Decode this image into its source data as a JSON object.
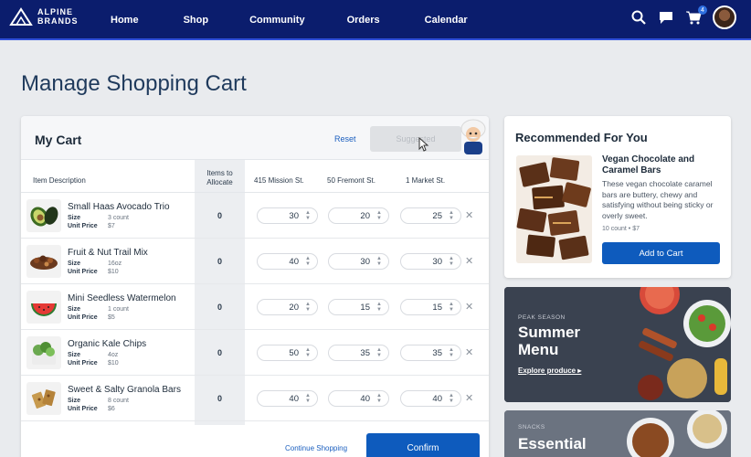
{
  "nav": {
    "brand_line1": "ALPINE",
    "brand_line2": "BRANDS",
    "links": [
      "Home",
      "Shop",
      "Community",
      "Orders",
      "Calendar"
    ],
    "cart_count": "4",
    "icons": [
      "search-icon",
      "chat-icon",
      "cart-icon",
      "avatar"
    ]
  },
  "page": {
    "title": "Manage Shopping Cart"
  },
  "cart": {
    "title": "My Cart",
    "reset_label": "Reset",
    "suggested_label": "Suggested",
    "columns": {
      "item": "Item Description",
      "alloc_line1": "Items to",
      "alloc_line2": "Allocate",
      "loc1": "415 Mission St.",
      "loc2": "50 Fremont St.",
      "loc3": "1 Market St."
    },
    "meta_labels": {
      "size": "Size",
      "price": "Unit Price"
    },
    "items": [
      {
        "name": "Small Haas Avocado Trio",
        "size": "3 count",
        "price": "$7",
        "alloc": "0",
        "q1": "30",
        "q2": "20",
        "q3": "25"
      },
      {
        "name": "Fruit & Nut Trail Mix",
        "size": "16oz",
        "price": "$10",
        "alloc": "0",
        "q1": "40",
        "q2": "30",
        "q3": "30"
      },
      {
        "name": "Mini Seedless Watermelon",
        "size": "1 count",
        "price": "$5",
        "alloc": "0",
        "q1": "20",
        "q2": "15",
        "q3": "15"
      },
      {
        "name": "Organic Kale Chips",
        "size": "4oz",
        "price": "$10",
        "alloc": "0",
        "q1": "50",
        "q2": "35",
        "q3": "35"
      },
      {
        "name": "Sweet & Salty Granola Bars",
        "size": "8 count",
        "price": "$6",
        "alloc": "0",
        "q1": "40",
        "q2": "40",
        "q3": "40"
      }
    ],
    "continue_label": "Continue Shopping",
    "confirm_label": "Confirm"
  },
  "recommended": {
    "title": "Recommended For You",
    "product_name": "Vegan Chocolate and Caramel Bars",
    "description": "These vegan chocolate caramel bars are buttery, chewy and satisfying without being sticky or overly sweet.",
    "meta": "10 count • $7",
    "add_label": "Add to Cart"
  },
  "promos": {
    "summer": {
      "eyebrow": "PEAK SEASON",
      "line1": "Summer",
      "line2": "Menu",
      "link": "Explore produce ▸"
    },
    "snacks": {
      "eyebrow": "SNACKS",
      "line1": "Essential"
    }
  },
  "colors": {
    "nav": "#0b1d6d",
    "primary": "#0e5bbd",
    "link": "#1b5fbf"
  }
}
